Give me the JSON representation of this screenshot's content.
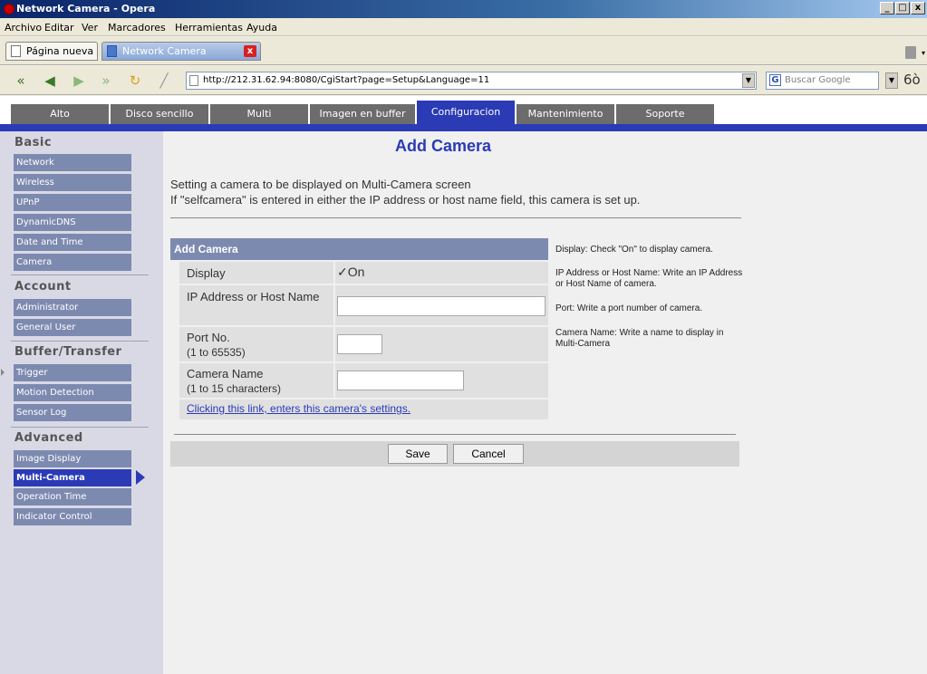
{
  "window": {
    "title": "Network Camera - Opera",
    "buttons": [
      "_",
      "□",
      "x"
    ]
  },
  "menu": [
    "Archivo",
    "Editar",
    "Ver",
    "Marcadores",
    "Herramientas",
    "Ayuda"
  ],
  "tabs": {
    "new_tab": "Página nueva",
    "active_tab": "Network Camera",
    "close": "x"
  },
  "address": {
    "url": "http://212.31.62.94:8080/CgiStart?page=Setup&Language=11",
    "search_placeholder": "Buscar Google",
    "search_engine_icon": "G"
  },
  "nav_buttons": [
    "rewind-icon",
    "back-icon",
    "forward-icon",
    "fast-forward-icon",
    "reload-icon",
    "edit-icon"
  ],
  "camera_nav": [
    {
      "label": "Alto",
      "active": false
    },
    {
      "label": "Disco sencillo",
      "active": false
    },
    {
      "label": "Multi",
      "active": false
    },
    {
      "label": "Imagen en buffer",
      "active": false
    },
    {
      "label": "Configuracion",
      "active": true
    },
    {
      "label": "Mantenimiento",
      "active": false
    },
    {
      "label": "Soporte",
      "active": false
    }
  ],
  "sidebar": {
    "basic": {
      "title": "Basic",
      "items": [
        "Network",
        "Wireless",
        "UPnP",
        "DynamicDNS",
        "Date and Time",
        "Camera"
      ]
    },
    "account": {
      "title": "Account",
      "items": [
        "Administrator",
        "General User"
      ]
    },
    "buffer": {
      "title": "Buffer/Transfer",
      "items": [
        "Trigger",
        "Motion Detection",
        "Sensor Log"
      ]
    },
    "advanced": {
      "title": "Advanced",
      "items": [
        "Image Display",
        "Multi-Camera",
        "Operation Time",
        "Indicator Control"
      ]
    },
    "active_item": "Multi-Camera"
  },
  "main": {
    "title": "Add Camera",
    "intro_line1": "Setting a camera to be displayed on Multi-Camera screen",
    "intro_line2": "If \"selfcamera\" is entered in either the IP address or host name field, this camera is set up.",
    "form": {
      "header": "Add Camera",
      "display_label": "Display",
      "display_check": "✓On",
      "ip_label": "IP Address or Host Name",
      "ip_value": "",
      "port_label": "Port No.",
      "port_hint": "(1 to 65535)",
      "port_value": "",
      "name_label": "Camera Name",
      "name_hint": "(1 to 15 characters)",
      "name_value": "",
      "link": "Clicking this link, enters this camera's settings."
    },
    "help": {
      "display": "Display: Check \"On\" to display camera.",
      "ip": "IP Address or Host Name: Write an IP Address or Host Name of camera.",
      "port": "Port: Write a port number of camera.",
      "name": "Camera Name: Write a name to display in Multi-Camera"
    },
    "buttons": {
      "save": "Save",
      "cancel": "Cancel"
    }
  }
}
